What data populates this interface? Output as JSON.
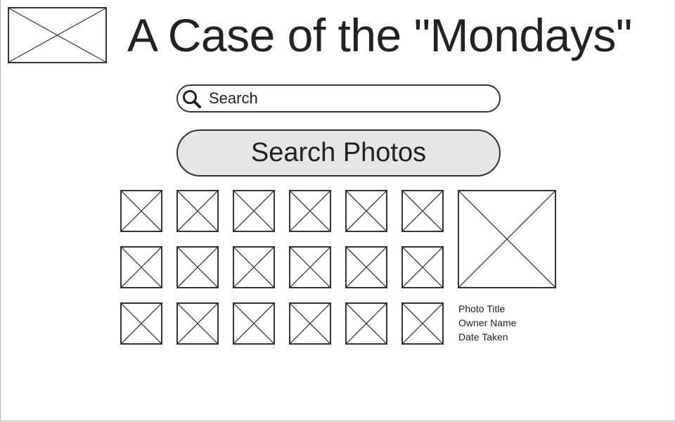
{
  "header": {
    "logo_icon": "image-placeholder-icon",
    "title": "A Case of the \"Mondays\""
  },
  "search": {
    "icon": "search-icon",
    "placeholder": "Search",
    "value": ""
  },
  "search_button": {
    "label": "Search Photos"
  },
  "gallery": {
    "rows": 3,
    "columns": 6,
    "thumbnail_icon": "image-placeholder-icon"
  },
  "preview": {
    "image_icon": "image-placeholder-icon",
    "photo_title": "Photo Title",
    "owner_name": "Owner Name",
    "date_taken": "Date Taken"
  },
  "colors": {
    "stroke": "#333333",
    "button_fill": "#e6e6e6",
    "text": "#222222"
  }
}
